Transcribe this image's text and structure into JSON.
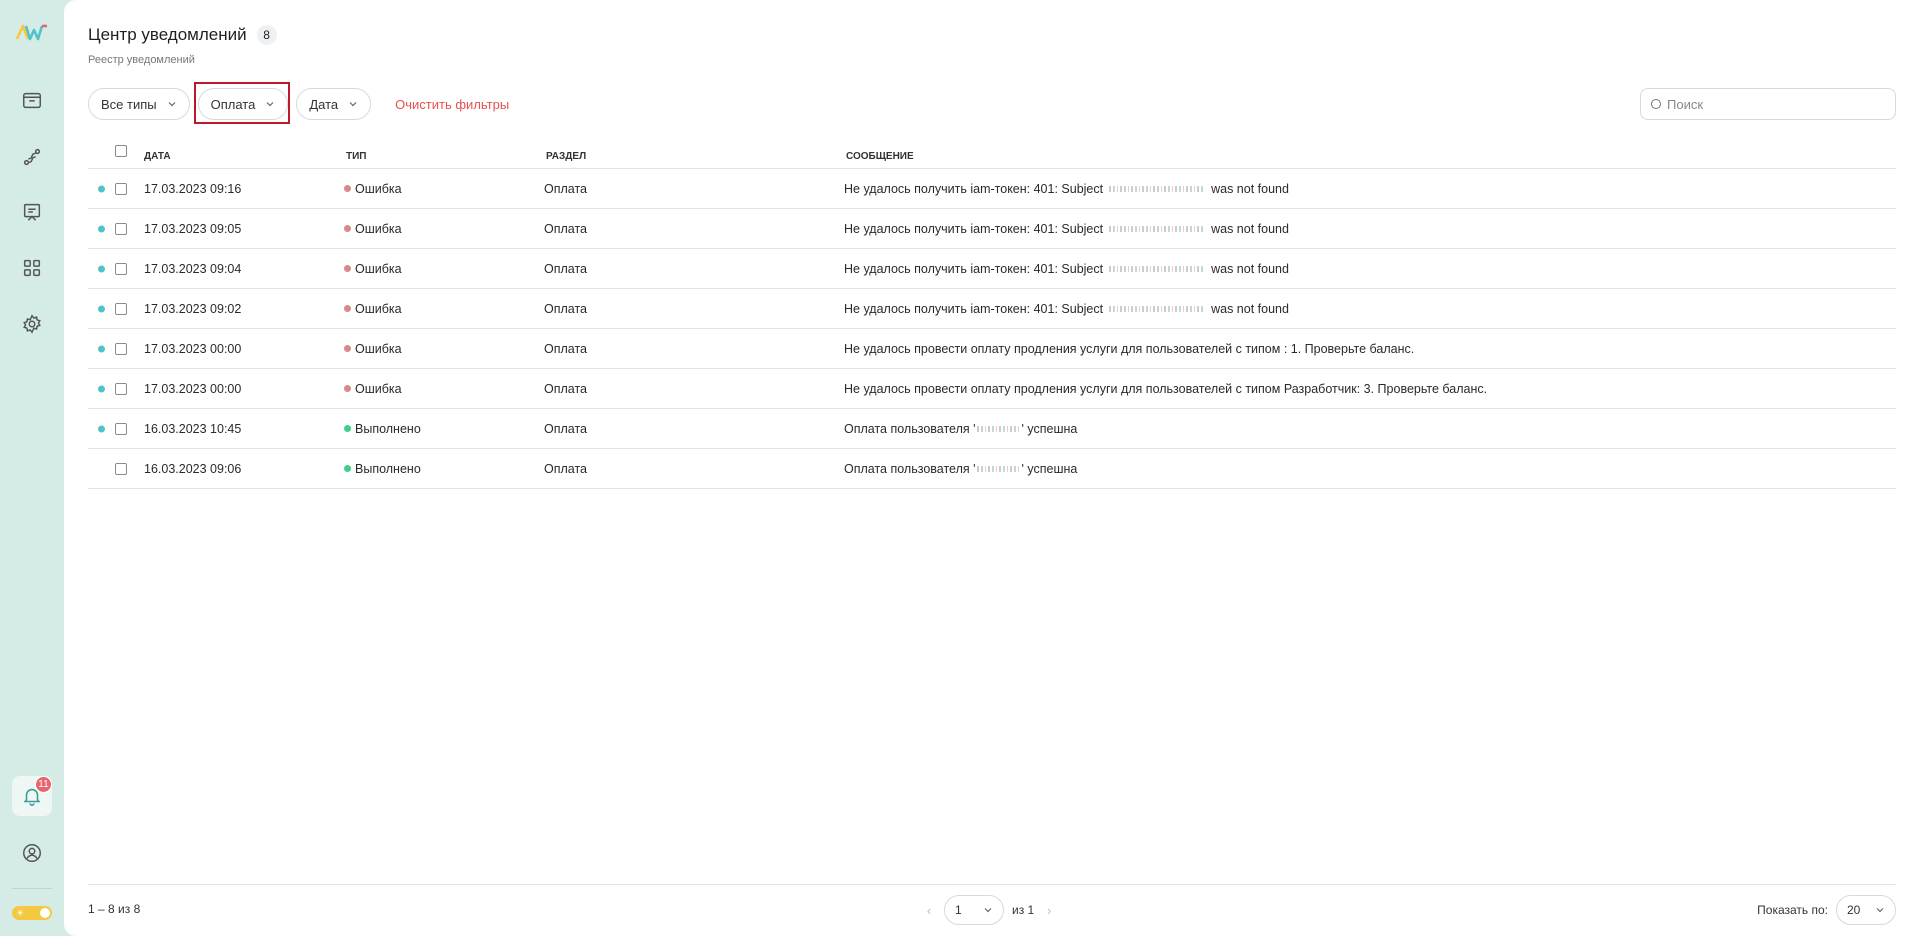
{
  "header": {
    "title": "Центр уведомлений",
    "count": "8",
    "subtitle": "Реестр уведомлений"
  },
  "filters": {
    "type_label": "Все типы",
    "section_label": "Оплата",
    "date_label": "Дата",
    "clear_label": "Очистить фильтры"
  },
  "search": {
    "placeholder": "Поиск"
  },
  "table": {
    "columns": {
      "date": "ДАТА",
      "type": "ТИП",
      "section": "РАЗДЕЛ",
      "message": "СООБЩЕНИЕ"
    },
    "rows": [
      {
        "date": "17.03.2023 09:16",
        "type": "Ошибка",
        "section": "Оплата",
        "msg_before": "Не удалось получить iam-токен: 401: Subject",
        "msg_after": "was not found",
        "unread": true
      },
      {
        "date": "17.03.2023 09:05",
        "type": "Ошибка",
        "section": "Оплата",
        "msg_before": "Не удалось получить iam-токен: 401: Subject",
        "msg_after": "was not found",
        "unread": true
      },
      {
        "date": "17.03.2023 09:04",
        "type": "Ошибка",
        "section": "Оплата",
        "msg_before": "Не удалось получить iam-токен: 401: Subject",
        "msg_after": "was not found",
        "unread": true
      },
      {
        "date": "17.03.2023 09:02",
        "type": "Ошибка",
        "section": "Оплата",
        "msg_before": "Не удалось получить iam-токен: 401: Subject",
        "msg_after": "was not found",
        "unread": true
      },
      {
        "date": "17.03.2023 00:00",
        "type": "Ошибка",
        "section": "Оплата",
        "msg_before": "Не удалось провести оплату продления услуги для пользователей с типом : 1. Проверьте баланс.",
        "msg_after": "",
        "unread": true
      },
      {
        "date": "17.03.2023 00:00",
        "type": "Ошибка",
        "section": "Оплата",
        "msg_before": "Не удалось провести оплату продления услуги для пользователей с типом Разработчик: 3. Проверьте баланс.",
        "msg_after": "",
        "unread": true
      },
      {
        "date": "16.03.2023 10:45",
        "type": "Выполнено",
        "section": "Оплата",
        "msg_before": "Оплата пользователя '",
        "msg_after": "' успешна",
        "unread": true
      },
      {
        "date": "16.03.2023 09:06",
        "type": "Выполнено",
        "section": "Оплата",
        "msg_before": "Оплата пользователя '",
        "msg_after": "' успешна",
        "unread": false
      }
    ]
  },
  "footer": {
    "range": "1 – 8 из 8",
    "page": "1",
    "of_pages": "из 1",
    "per_page_label": "Показать по:",
    "per_page_value": "20"
  },
  "sidebar": {
    "notifications_badge": "11"
  },
  "colors": {
    "accent": "#4fc3c9",
    "error_dot": "#d98888",
    "success_dot": "#3fcf87",
    "danger_text": "#e8504f",
    "sidebar_bg": "#d5ebe5"
  }
}
